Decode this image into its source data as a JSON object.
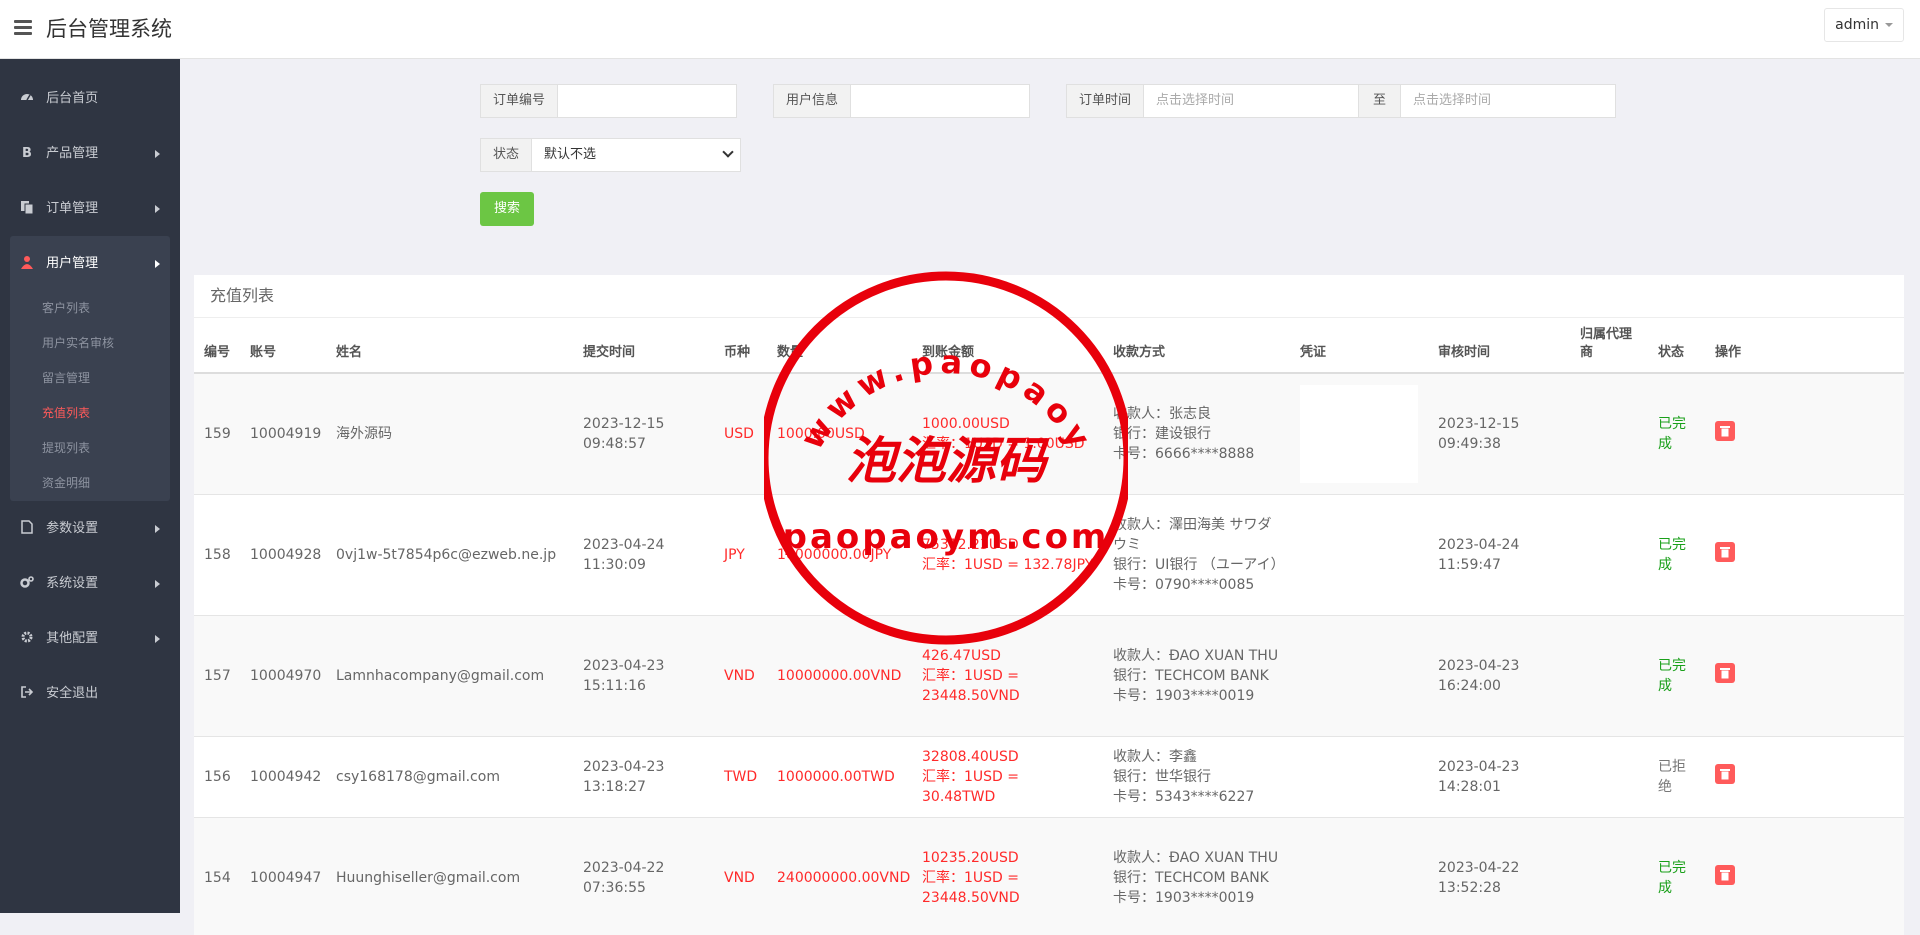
{
  "header": {
    "title": "后台管理系统",
    "user": "admin"
  },
  "sidebar": {
    "items": [
      {
        "label": "后台首页",
        "icon": "dashboard-icon"
      },
      {
        "label": "产品管理",
        "icon": "bitcoin-icon"
      },
      {
        "label": "订单管理",
        "icon": "copy-icon"
      },
      {
        "label": "用户管理",
        "icon": "user-icon"
      },
      {
        "label": "参数设置",
        "icon": "file-icon"
      },
      {
        "label": "系统设置",
        "icon": "cogs-icon"
      },
      {
        "label": "其他配置",
        "icon": "gear-icon"
      },
      {
        "label": "安全退出",
        "icon": "sign-out-icon"
      }
    ],
    "sub_items": [
      "客户列表",
      "用户实名审核",
      "留言管理",
      "充值列表",
      "提现列表",
      "资金明细"
    ],
    "active_sub": "充值列表"
  },
  "filters": {
    "order_no_label": "订单编号",
    "user_info_label": "用户信息",
    "order_time_label": "订单时间",
    "time_start_placeholder": "点击选择时间",
    "to_label": "至",
    "time_end_placeholder": "点击选择时间",
    "status_label": "状态",
    "status_value": "默认不选",
    "search_label": "搜索"
  },
  "panel": {
    "title": "充值列表",
    "columns": [
      "编号",
      "账号",
      "姓名",
      "提交时间",
      "币种",
      "数量",
      "到账金额",
      "收款方式",
      "凭证",
      "审核时间",
      "归属代理商",
      "状态",
      "操作"
    ]
  },
  "rows": [
    {
      "id": "159",
      "account": "10004919",
      "name": "海外源码",
      "submit_date": "2023-12-15",
      "submit_time": "09:48:57",
      "currency": "USD",
      "amount": "1000.00USD",
      "arrival": "1000.00USD",
      "rate": "汇率：1USD = 1.00USD",
      "payee": "收款人：张志良",
      "bank": "银行：建设银行",
      "card": "卡号：6666****8888",
      "review_date": "2023-12-15",
      "review_time": "09:49:38",
      "status": "已完成"
    },
    {
      "id": "158",
      "account": "10004928",
      "name": "0vj1w-5t7854p6c@ezweb.ne.jp",
      "submit_date": "2023-04-24",
      "submit_time": "11:30:09",
      "currency": "JPY",
      "amount": "10000000.00JPY",
      "arrival": "75312.23USD",
      "rate": "汇率：1USD = 132.78JPY",
      "payee": "收款人：澤田海美 サワダウミ",
      "bank": "银行：UI银行 （ユーアイ）",
      "card": "卡号：0790****0085",
      "review_date": "2023-04-24",
      "review_time": "11:59:47",
      "status": "已完成"
    },
    {
      "id": "157",
      "account": "10004970",
      "name": "Lamnhacompany@gmail.com",
      "submit_date": "2023-04-23",
      "submit_time": "15:11:16",
      "currency": "VND",
      "amount": "10000000.00VND",
      "arrival": "426.47USD",
      "rate": "汇率：1USD = 23448.50VND",
      "payee": "收款人：ĐAO XUAN THU",
      "bank": "银行：TECHCOM BANK",
      "card": "卡号：1903****0019",
      "review_date": "2023-04-23",
      "review_time": "16:24:00",
      "status": "已完成"
    },
    {
      "id": "156",
      "account": "10004942",
      "name": "csy168178@gmail.com",
      "submit_date": "2023-04-23",
      "submit_time": "13:18:27",
      "currency": "TWD",
      "amount": "1000000.00TWD",
      "arrival": "32808.40USD",
      "rate": "汇率：1USD = 30.48TWD",
      "payee": "收款人：李鑫",
      "bank": "银行：世华银行",
      "card": "卡号：5343****6227",
      "review_date": "2023-04-23",
      "review_time": "14:28:01",
      "status": "已拒绝"
    },
    {
      "id": "154",
      "account": "10004947",
      "name": "Huunghiseller@gmail.com",
      "submit_date": "2023-04-22",
      "submit_time": "07:36:55",
      "currency": "VND",
      "amount": "240000000.00VND",
      "arrival": "10235.20USD",
      "rate": "汇率：1USD = 23448.50VND",
      "payee": "收款人：ĐAO XUAN THU",
      "bank": "银行：TECHCOM BANK",
      "card": "卡号：1903****0019",
      "review_date": "2023-04-22",
      "review_time": "13:52:28",
      "status": "已完成"
    }
  ],
  "watermark": {
    "arc_text": "www.paopaoym.com",
    "center_text": "泡泡源码",
    "bottom_text": "paopaoym.com",
    "color": "#e8000b"
  },
  "colors": {
    "sidebar_bg": "#2f3542",
    "accent_red": "#ff2a2a",
    "success_green": "#1aa01a",
    "search_button": "#6cc644"
  }
}
